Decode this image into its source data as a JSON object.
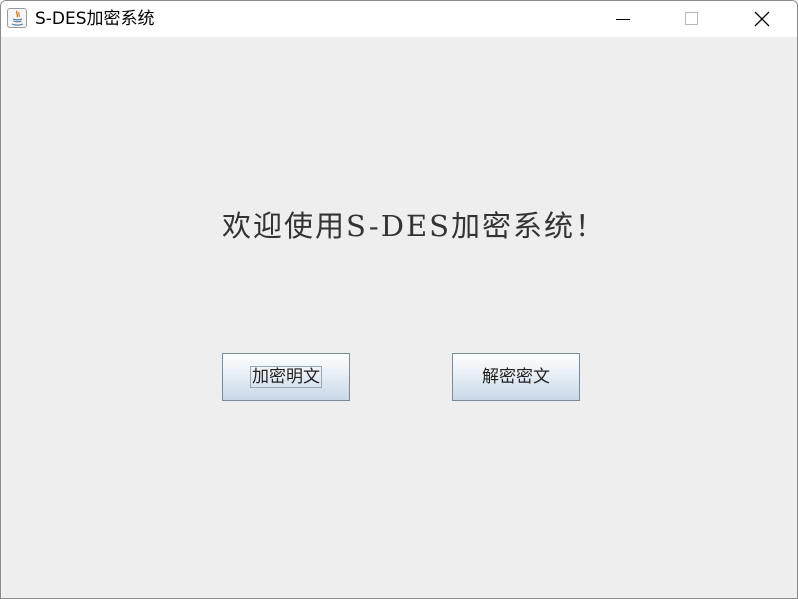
{
  "window": {
    "title": "S-DES加密系统",
    "icon": "java-cup-icon",
    "controls": [
      "minimize-icon",
      "maximize-icon",
      "close-icon"
    ]
  },
  "main": {
    "welcome_text": "欢迎使用S-DES加密系统！",
    "buttons": {
      "encrypt_label": "加密明文",
      "decrypt_label": "解密密文"
    }
  },
  "colors": {
    "titlebar": "#ffffff",
    "content_bg": "#eeeeee",
    "welcome_text": "#333333",
    "button_border": "#7a8a99",
    "java_icon_red": "#e76f00",
    "java_icon_blue": "#5382a1"
  }
}
